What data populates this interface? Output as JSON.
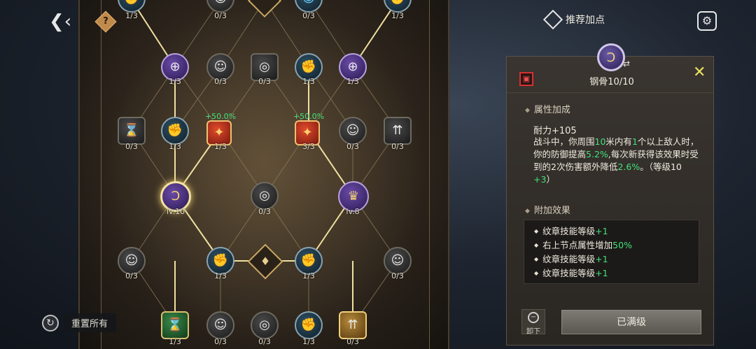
{
  "hud": {
    "back_icon": "back-arrow-icon",
    "help_label": "?",
    "recommend_label": "推荐加点",
    "reset_label": "重置所有"
  },
  "tree": {
    "row_top": [
      {
        "label": "1/3"
      },
      {
        "label": "0/3"
      },
      {
        "label": "0/3"
      },
      {
        "label": "1/3"
      }
    ],
    "row1": [
      {
        "label": "1/3",
        "icon": "crosshair-icon"
      },
      {
        "label": "0/3",
        "icon": "body-icon"
      },
      {
        "label": "0/3",
        "icon": "target-icon"
      },
      {
        "label": "1/3",
        "icon": "muscle-icon"
      },
      {
        "label": "1/3",
        "icon": "crosshair-icon"
      }
    ],
    "row2": [
      {
        "label": "0/3",
        "icon": "hourglass-icon"
      },
      {
        "label": "1/3",
        "icon": "muscle-icon"
      },
      {
        "label": "1/3",
        "icon": "shield-burst-icon",
        "bonus": "+50.0%"
      },
      {
        "label": "3/3",
        "icon": "shield-burst-icon",
        "bonus": "+50.0%"
      },
      {
        "label": "0/3",
        "icon": "body-icon"
      },
      {
        "label": "0/3",
        "icon": "arrows-up-icon"
      }
    ],
    "row3": [
      {
        "label": "lv.10",
        "icon": "rune-icon"
      },
      {
        "label": "0/3",
        "icon": "target-icon"
      },
      {
        "label": "lv.8",
        "icon": "crown-icon"
      }
    ],
    "row4": [
      {
        "label": "0/3",
        "icon": "body-icon"
      },
      {
        "label": "1/3",
        "icon": "muscle-icon"
      },
      {
        "label": "1/3",
        "icon": "muscle-icon"
      },
      {
        "label": "0/3",
        "icon": "body-icon"
      }
    ],
    "row5": [
      {
        "label": "1/3",
        "icon": "hourglass-icon"
      },
      {
        "label": "0/3",
        "icon": "body-icon"
      },
      {
        "label": "0/3",
        "icon": "target-icon"
      },
      {
        "label": "1/3",
        "icon": "muscle-icon"
      },
      {
        "label": "0/3",
        "icon": "arrows-up-icon"
      }
    ]
  },
  "panel": {
    "skill_name": "钢骨10/10",
    "section_attr": "属性加成",
    "stat": "耐力+105",
    "desc": {
      "p1": "战斗中，你周围",
      "v1": "10",
      "p2": "米内有",
      "v2": "1",
      "p3": "个以上敌人时，你的防御提高",
      "v3": "5.2%",
      "p4": ",每次新获得该效果时受到的2次伤害额外降低",
      "v4": "2.6%",
      "p5": "。（等级10 ",
      "v5": "+3",
      "p6": "）"
    },
    "section_extra": "附加效果",
    "extra": [
      {
        "text": "纹章技能等级",
        "value": "+1"
      },
      {
        "text": "右上节点属性增加",
        "value": "50%"
      },
      {
        "text": "纹章技能等级",
        "value": "+1"
      },
      {
        "text": "纹章技能等级",
        "value": "+1"
      }
    ],
    "unequip_label": "卸下",
    "maxed_label": "已满级"
  },
  "colors": {
    "bonus_green": "#42e27a",
    "close_yellow": "#e8e060",
    "lock_red": "#d83030"
  }
}
